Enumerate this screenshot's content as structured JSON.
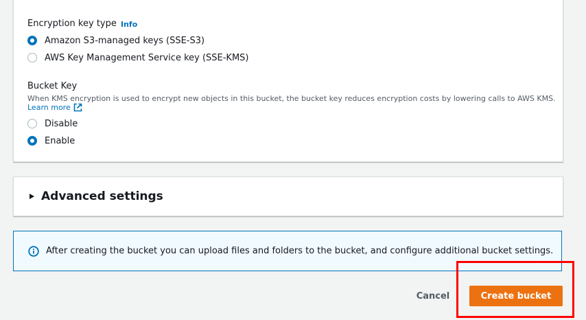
{
  "encryption": {
    "key_type_label": "Encryption key type",
    "info_link": "Info",
    "options": [
      {
        "label": "Amazon S3-managed keys (SSE-S3)",
        "checked": true
      },
      {
        "label": "AWS Key Management Service key (SSE-KMS)",
        "checked": false
      }
    ]
  },
  "bucket_key": {
    "label": "Bucket Key",
    "description": "When KMS encryption is used to encrypt new objects in this bucket, the bucket key reduces encryption costs by lowering calls to AWS KMS.",
    "learn_more": "Learn more",
    "options": [
      {
        "label": "Disable",
        "checked": false
      },
      {
        "label": "Enable",
        "checked": true
      }
    ]
  },
  "advanced": {
    "title": "Advanced settings",
    "expanded": false
  },
  "alert": {
    "text": "After creating the bucket you can upload files and folders to the bucket, and configure additional bucket settings.",
    "icon": "info-circle-icon"
  },
  "footer": {
    "cancel_label": "Cancel",
    "create_label": "Create bucket"
  },
  "colors": {
    "accent": "#0073bb",
    "primary_button": "#ec7211",
    "highlight": "#ff0000",
    "background": "#f2f3f3"
  }
}
